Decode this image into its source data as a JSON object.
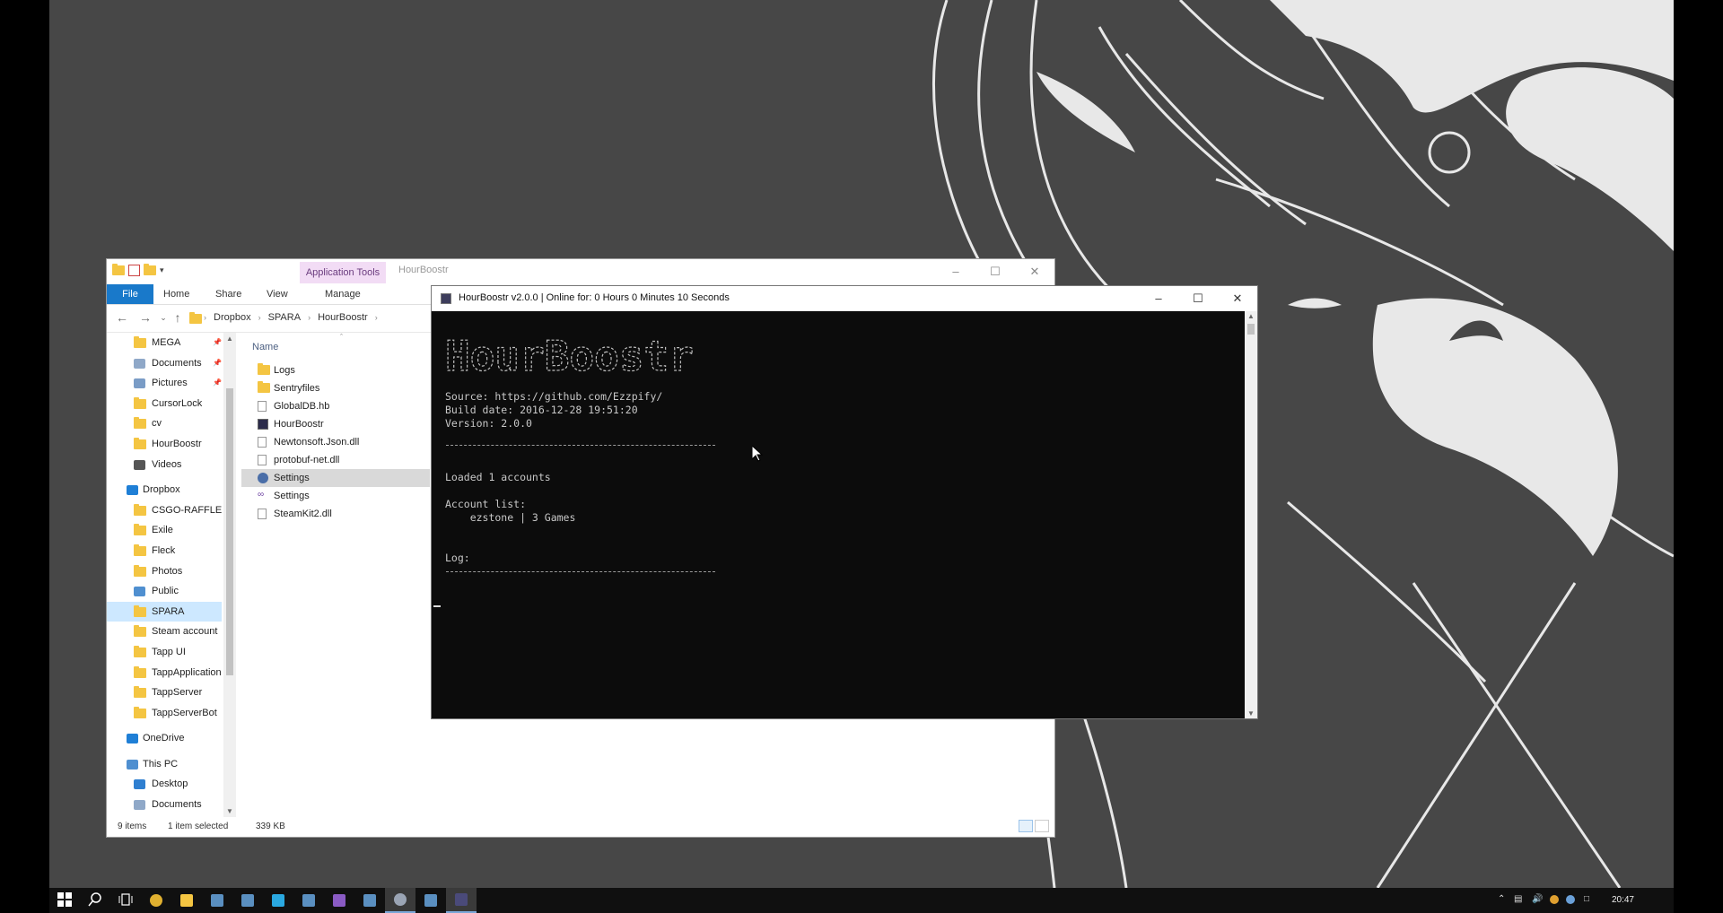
{
  "explorer": {
    "title": "HourBoostr",
    "app_tools_label": "Application Tools",
    "ribbon_tabs": [
      "File",
      "Home",
      "Share",
      "View",
      "Manage"
    ],
    "breadcrumb": [
      "Dropbox",
      "SPARA",
      "HourBoostr"
    ],
    "column_name": "Name",
    "nav_items": [
      {
        "label": "MEGA",
        "icon": "folder-icon",
        "pinned": true
      },
      {
        "label": "Documents",
        "icon": "documents-icon",
        "pinned": true
      },
      {
        "label": "Pictures",
        "icon": "pictures-icon",
        "pinned": true
      },
      {
        "label": "CursorLock",
        "icon": "folder-icon"
      },
      {
        "label": "cv",
        "icon": "folder-icon"
      },
      {
        "label": "HourBoostr",
        "icon": "folder-icon"
      },
      {
        "label": "Videos",
        "icon": "videos-icon"
      },
      {
        "label": "Dropbox",
        "icon": "dropbox-icon"
      },
      {
        "label": "CSGO-RAFFLE",
        "icon": "folder-icon"
      },
      {
        "label": "Exile",
        "icon": "folder-icon"
      },
      {
        "label": "Fleck",
        "icon": "folder-icon"
      },
      {
        "label": "Photos",
        "icon": "folder-icon"
      },
      {
        "label": "Public",
        "icon": "public-icon"
      },
      {
        "label": "SPARA",
        "icon": "folder-icon",
        "selected": true
      },
      {
        "label": "Steam account",
        "icon": "folder-icon"
      },
      {
        "label": "Tapp UI",
        "icon": "folder-icon"
      },
      {
        "label": "TappApplication",
        "icon": "folder-icon"
      },
      {
        "label": "TappServer",
        "icon": "folder-icon"
      },
      {
        "label": "TappServerBot",
        "icon": "folder-icon"
      },
      {
        "label": "OneDrive",
        "icon": "onedrive-icon"
      },
      {
        "label": "This PC",
        "icon": "pc-icon"
      },
      {
        "label": "Desktop",
        "icon": "desktop-icon"
      },
      {
        "label": "Documents",
        "icon": "documents-icon"
      }
    ],
    "files": [
      {
        "label": "Logs",
        "icon": "folder-icon"
      },
      {
        "label": "Sentryfiles",
        "icon": "folder-icon"
      },
      {
        "label": "GlobalDB.hb",
        "icon": "file-icon"
      },
      {
        "label": "HourBoostr",
        "icon": "app-icon"
      },
      {
        "label": "Newtonsoft.Json.dll",
        "icon": "dll-icon"
      },
      {
        "label": "protobuf-net.dll",
        "icon": "dll-icon"
      },
      {
        "label": "Settings",
        "icon": "settings-icon",
        "selected": true
      },
      {
        "label": "Settings",
        "icon": "visual-studio-icon"
      },
      {
        "label": "SteamKit2.dll",
        "icon": "dll-icon"
      }
    ],
    "status": {
      "items": "9 items",
      "selected": "1 item selected",
      "size": "339 KB"
    }
  },
  "console": {
    "title": "HourBoostr v2.0.0 | Online for: 0 Hours 0 Minutes 10 Seconds",
    "banner": "HourBoostr",
    "source": "Source: https://github.com/Ezzpify/",
    "build_date": "Build date: 2016-12-28 19:51:20",
    "version": "Version: 2.0.0",
    "loaded": "Loaded 1 accounts",
    "account_list_label": "Account list:",
    "account_entry": "    ezstone | 3 Games",
    "log_label": "Log:"
  },
  "taskbar": {
    "clock": "20:47",
    "apps": [
      {
        "name": "start-button",
        "icon": "windows-icon"
      },
      {
        "name": "search-button",
        "icon": "search-icon"
      },
      {
        "name": "task-view-button",
        "icon": "task-view-icon"
      },
      {
        "name": "chrome-button",
        "icon": "chrome-icon"
      },
      {
        "name": "file-explorer-button",
        "icon": "folder-icon"
      },
      {
        "name": "app-button-1",
        "icon": "app-icon"
      },
      {
        "name": "app-button-2",
        "icon": "app-icon"
      },
      {
        "name": "skype-button",
        "icon": "skype-icon"
      },
      {
        "name": "app-button-3",
        "icon": "app-icon"
      },
      {
        "name": "visual-studio-button",
        "icon": "visual-studio-icon"
      },
      {
        "name": "app-button-4",
        "icon": "app-icon"
      },
      {
        "name": "steam-button",
        "icon": "steam-icon"
      },
      {
        "name": "app-button-5",
        "icon": "app-icon"
      },
      {
        "name": "hourboostr-button",
        "icon": "hourboostr-icon"
      }
    ]
  }
}
